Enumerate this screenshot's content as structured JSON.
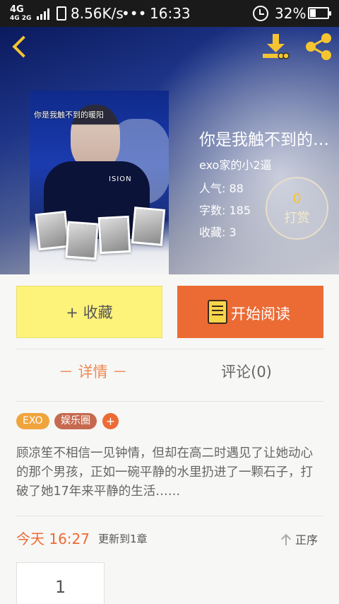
{
  "status_bar": {
    "network": "4G",
    "network_sub": "4G 2G",
    "speed": "8.56K/s",
    "overflow": "•••",
    "time": "16:33",
    "battery_percent": "32%",
    "battery_level": 0.32
  },
  "header": {
    "back_icon": "chevron-left-icon",
    "download_icon": "download-icon",
    "share_icon": "share-icon",
    "accent_color": "#f5c531"
  },
  "book": {
    "title": "你是我触不到的暖阳",
    "cover_title": "你是我触不到的暖阳",
    "cover_text": "ISION",
    "author": "exo家的小2逼",
    "popularity_label": "人气:",
    "popularity": "88",
    "words_label": "字数:",
    "words": "185",
    "favorites_label": "收藏:",
    "favorites": "3",
    "tip_amount": "0",
    "tip_label": "打赏"
  },
  "actions": {
    "favorite_label": "+ 收藏",
    "read_label": "开始阅读",
    "read_icon": "book-icon",
    "favorite_color": "#fdf27a",
    "read_color": "#ec6b35"
  },
  "tabs": {
    "detail": "－ 详情 －",
    "comments": "评论(0)"
  },
  "tags": [
    "EXO",
    "娱乐圈",
    "+"
  ],
  "description": "顾凉笙不相信一见钟情，但却在高二时遇见了让她动心的那个男孩，正如一碗平静的水里扔进了一颗石子，打破了她17年来平静的生活……",
  "update": {
    "when": "今天 16:27",
    "note": "更新到1章",
    "sort_label": "正序"
  },
  "chapters": [
    "1"
  ]
}
